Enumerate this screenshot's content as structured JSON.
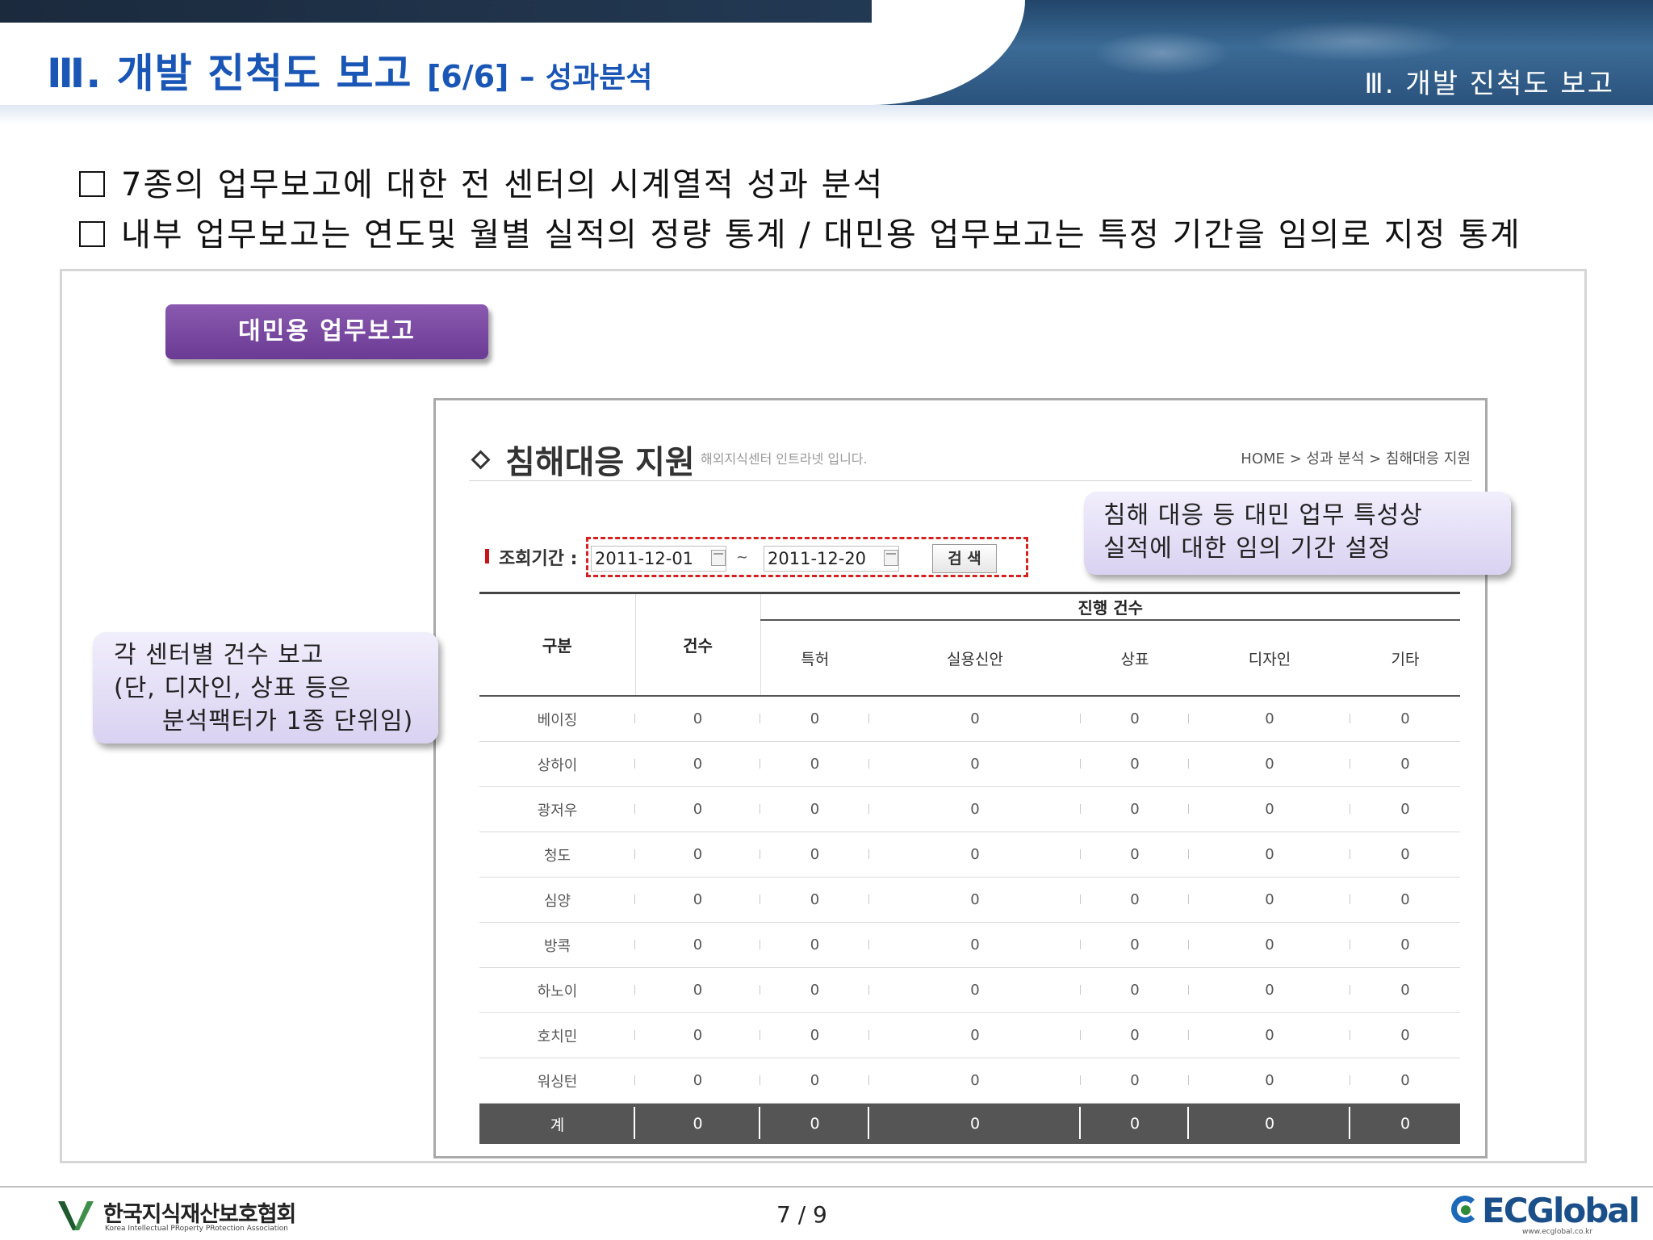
{
  "header": {
    "title_numeral": "Ⅲ. ",
    "title_main": "개발 진척도 보고 ",
    "title_progress": "[6/6]",
    "title_dash": " – ",
    "title_sub": "성과분석",
    "section_label": "Ⅲ. 개발 진척도 보고"
  },
  "bullets": [
    "7종의 업무보고에 대한 전 센터의 시계열적 성과 분석",
    "내부 업무보고는 연도및 월별 실적의 정량 통계 / 대민용 업무보고는 특정 기간을 임의로 지정 통계"
  ],
  "panel_button": "대민용 업무보고",
  "callout_left": {
    "line1": "각 센터별 건수 보고",
    "line2": "(단, 디자인, 상표 등은",
    "line3": "분석팩터가 1종 단위임)"
  },
  "callout_right": {
    "line1": "침해 대응 등 대민 업무 특성상",
    "line2": "실적에 대한 임의 기간 설정"
  },
  "inner_page": {
    "heading": "침해대응 지원",
    "subheading": "해외지식센터 인트라넷 입니다.",
    "breadcrumb": "HOME > 성과 분석 > 침해대응 지원",
    "query_label": "조회기간 :",
    "date_from": "2011-12-01",
    "date_to": "2011-12-20",
    "tilde": "~",
    "search_button": "검 색",
    "table": {
      "col_category": "구분",
      "col_count": "건수",
      "group_header": "진행 건수",
      "sub_columns": [
        "특허",
        "실용신안",
        "상표",
        "디자인",
        "기타"
      ],
      "rows": [
        {
          "name": "베이징",
          "values": [
            "0",
            "0",
            "0",
            "0",
            "0",
            "0"
          ]
        },
        {
          "name": "상하이",
          "values": [
            "0",
            "0",
            "0",
            "0",
            "0",
            "0"
          ]
        },
        {
          "name": "광저우",
          "values": [
            "0",
            "0",
            "0",
            "0",
            "0",
            "0"
          ]
        },
        {
          "name": "청도",
          "values": [
            "0",
            "0",
            "0",
            "0",
            "0",
            "0"
          ]
        },
        {
          "name": "심양",
          "values": [
            "0",
            "0",
            "0",
            "0",
            "0",
            "0"
          ]
        },
        {
          "name": "방콕",
          "values": [
            "0",
            "0",
            "0",
            "0",
            "0",
            "0"
          ]
        },
        {
          "name": "하노이",
          "values": [
            "0",
            "0",
            "0",
            "0",
            "0",
            "0"
          ]
        },
        {
          "name": "호치민",
          "values": [
            "0",
            "0",
            "0",
            "0",
            "0",
            "0"
          ]
        },
        {
          "name": "워싱턴",
          "values": [
            "0",
            "0",
            "0",
            "0",
            "0",
            "0"
          ]
        }
      ],
      "total": {
        "name": "계",
        "values": [
          "0",
          "0",
          "0",
          "0",
          "0",
          "0"
        ]
      }
    }
  },
  "footer": {
    "org_name_kr": "한국지식재산보호협회",
    "org_name_en": "Korea Intellectual PRoperty PRotection Association",
    "page": "7 / 9",
    "brand": "ECGlobal",
    "brand_url": "www.ecglobal.co.kr"
  },
  "colors": {
    "title_blue": "#1a56b6",
    "button_purple": "#6b3b94",
    "callout_lavender": "#d9d2f1",
    "dash_red": "#d52020",
    "total_row": "#555555"
  },
  "icons": [
    "diamond-icon",
    "calendar-icon",
    "checkbox-square-icon"
  ]
}
